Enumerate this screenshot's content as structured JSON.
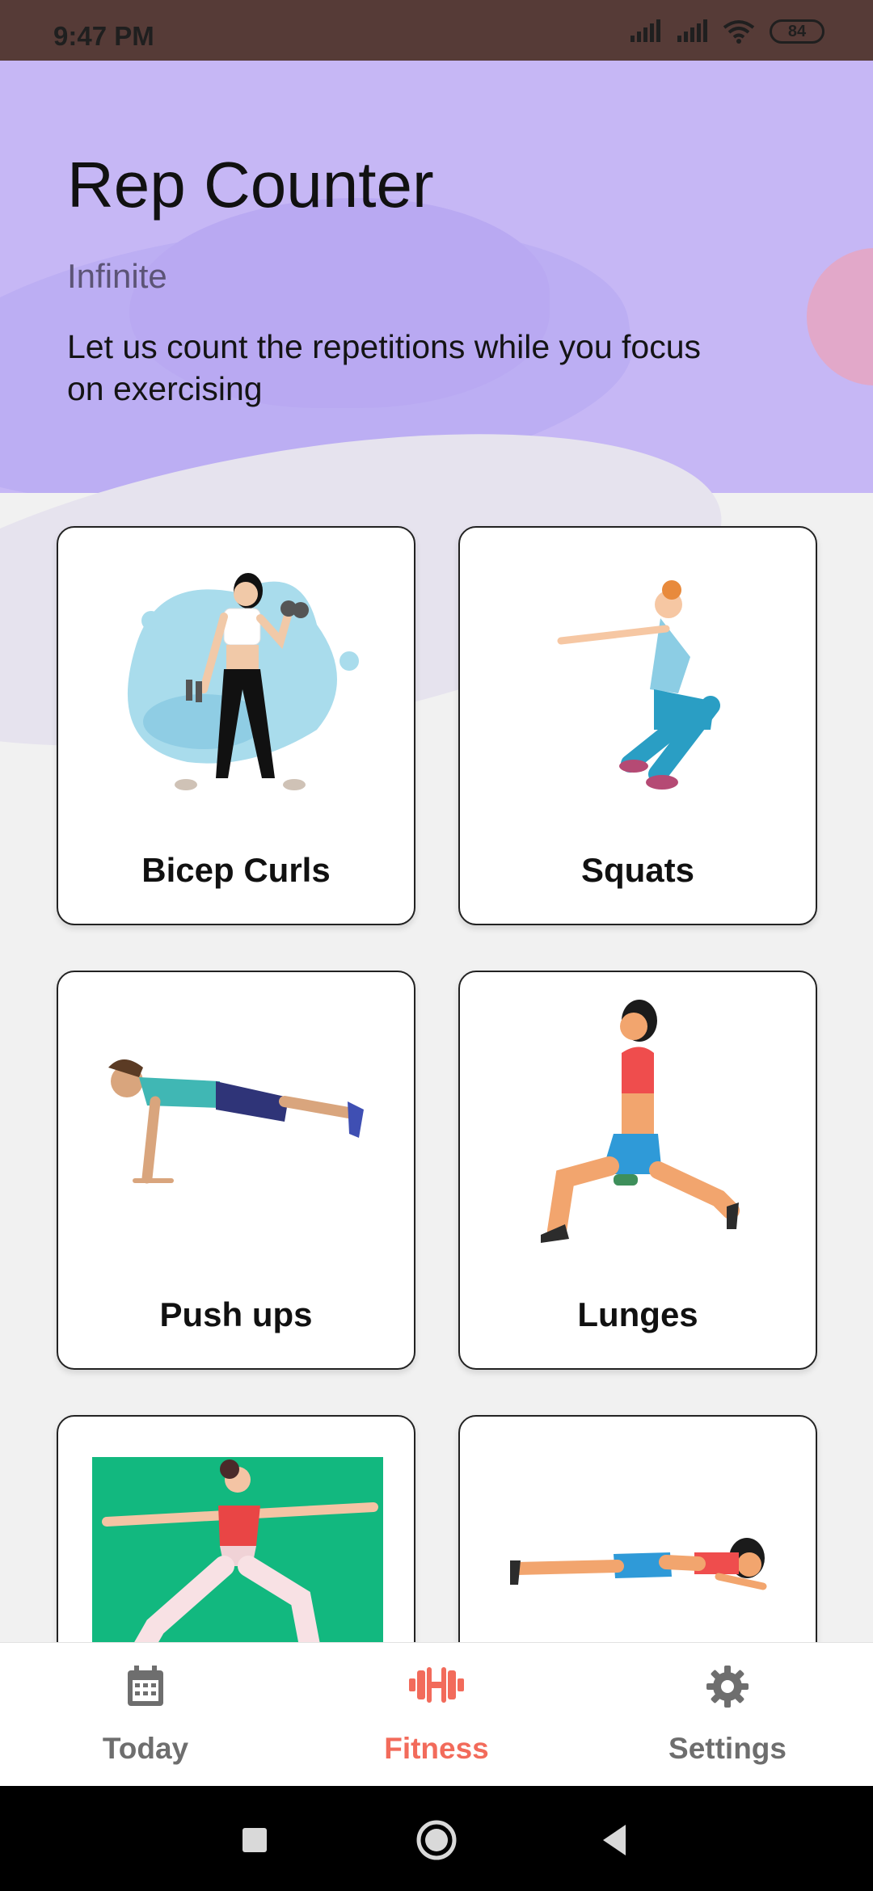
{
  "status_bar": {
    "time": "9:47 PM",
    "battery": "84"
  },
  "header": {
    "title": "Rep Counter",
    "subtitle": "Infinite",
    "description": "Let us count the repetitions while you focus on exercising"
  },
  "exercises": [
    {
      "label": "Bicep Curls",
      "icon": "bicep-curl-illustration"
    },
    {
      "label": "Squats",
      "icon": "squat-illustration"
    },
    {
      "label": "Push ups",
      "icon": "push-up-illustration"
    },
    {
      "label": "Lunges",
      "icon": "lunge-illustration"
    },
    {
      "label": "",
      "icon": "warrior-pose-illustration"
    },
    {
      "label": "",
      "icon": "plank-illustration"
    }
  ],
  "bottom_nav": {
    "items": [
      {
        "label": "Today",
        "icon": "calendar-icon"
      },
      {
        "label": "Fitness",
        "icon": "dumbbell-icon"
      },
      {
        "label": "Settings",
        "icon": "gear-icon"
      }
    ],
    "active": "Fitness"
  },
  "colors": {
    "header_bg": "#c6b7f5",
    "accent": "#f26b5b",
    "status_bar_bg": "#563b37"
  }
}
